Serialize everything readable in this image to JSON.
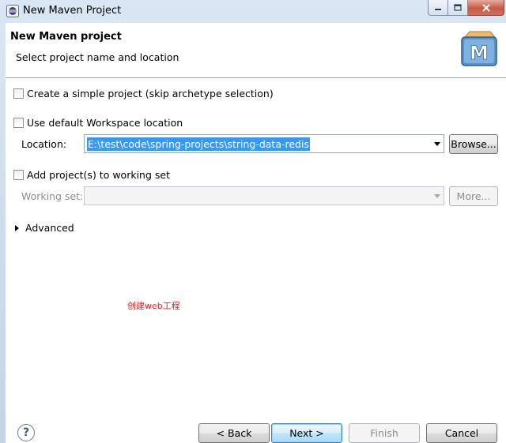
{
  "window": {
    "title": "New Maven Project"
  },
  "banner": {
    "title": "New Maven project",
    "description": "Select project name and location",
    "logo_letter": "M"
  },
  "options": {
    "simple_project_label": "Create a simple project (skip archetype selection)",
    "simple_project_checked": false,
    "default_workspace_label": "Use default Workspace location",
    "default_workspace_checked": false,
    "location_label": "Location:",
    "location_value": "E:\\test\\code\\spring-projects\\string-data-redis",
    "browse_label": "Browse...",
    "working_set_checkbox_label": "Add project(s) to working set",
    "working_set_checked": false,
    "working_set_label": "Working set:",
    "working_set_value": "",
    "more_label": "More...",
    "advanced_label": "Advanced"
  },
  "annotation": {
    "text": "创建web工程",
    "color": "#e0201a"
  },
  "footer": {
    "help_glyph": "?",
    "back_label": "< Back",
    "next_label": "Next >",
    "finish_label": "Finish",
    "cancel_label": "Cancel"
  }
}
